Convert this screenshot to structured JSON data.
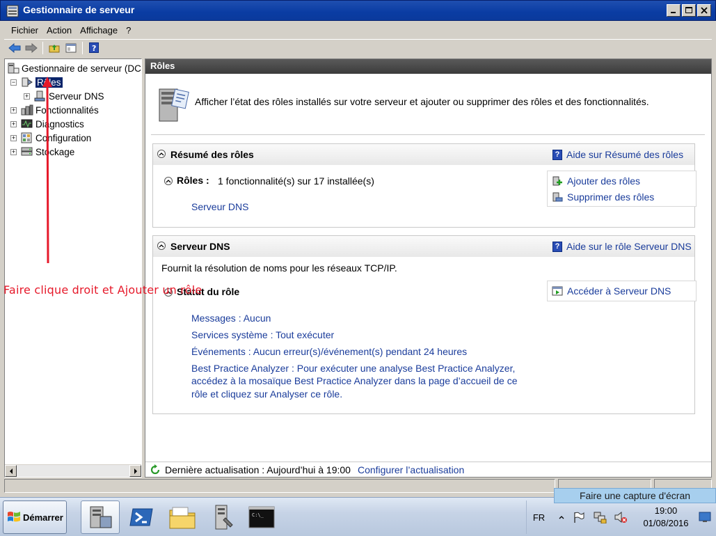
{
  "window": {
    "title": "Gestionnaire de serveur"
  },
  "menu": [
    "Fichier",
    "Action",
    "Affichage",
    "?"
  ],
  "tree": {
    "root": "Gestionnaire de serveur (DC",
    "items": [
      {
        "label": "Rôles",
        "selected": true
      },
      {
        "label": "Serveur DNS"
      },
      {
        "label": "Fonctionnalités"
      },
      {
        "label": "Diagnostics"
      },
      {
        "label": "Configuration"
      },
      {
        "label": "Stockage"
      }
    ]
  },
  "content": {
    "header": "Rôles",
    "intro": "Afficher l’état des rôles installés sur votre serveur et ajouter ou supprimer des rôles et des fonctionnalités.",
    "summary": {
      "title": "Résumé des rôles",
      "help": "Aide sur Résumé des rôles",
      "roles_label": "Rôles :",
      "roles_count": "1 fonctionnalité(s) sur 17 installée(s)",
      "role_link": "Serveur DNS",
      "add_roles": "Ajouter des rôles",
      "remove_roles": "Supprimer des rôles"
    },
    "dns": {
      "title": "Serveur DNS",
      "help": "Aide sur le rôle Serveur DNS",
      "description": "Fournit la résolution de noms pour les réseaux TCP/IP.",
      "status_title": "Statut du rôle",
      "goto": "Accéder à Serveur DNS",
      "messages": "Messages : Aucun",
      "services": "Services système : Tout exécuter",
      "events": "Événements : Aucun erreur(s)/événement(s) pendant 24 heures",
      "bpa_line1": "Best Practice Analyzer : Pour exécuter une analyse Best Practice Analyzer,",
      "bpa_line2": "accédez à la mosaïque Best Practice Analyzer dans la page d’accueil de ce",
      "bpa_line3": "rôle et cliquez sur Analyser ce rôle."
    },
    "status": {
      "last_refresh": "Dernière actualisation : Aujourd’hui à 19:00",
      "configure": "Configurer l’actualisation"
    }
  },
  "taskbar": {
    "start": "Démarrer",
    "language": "FR",
    "time": "19:00",
    "date": "01/08/2016"
  },
  "overlay": {
    "capture": "Faire une capture d'écran",
    "annotation": "Faire clique droit et Ajouter un rôle",
    "annotation_color": "#e6192a"
  }
}
